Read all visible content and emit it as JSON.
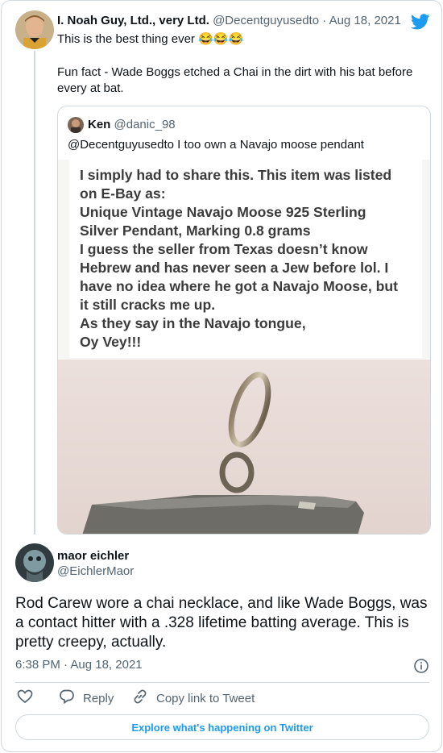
{
  "parent": {
    "name": "I. Noah Guy, Ltd., very Ltd.",
    "handle": "@Decentguyusedto",
    "dot": "·",
    "date": "Aug 18, 2021",
    "line1": "This is the best thing ever",
    "emojis": "😂😂😂",
    "text2": "Fun fact - Wade Boggs etched a Chai in the dirt with his bat before every at bat."
  },
  "quote": {
    "name": "Ken",
    "handle": "@danic_98",
    "text": "@Decentguyusedto I too own a Navajo moose pendant",
    "image_text": [
      "I simply had to share this. This item was listed",
      "on E-Bay as:",
      "Unique Vintage Navajo Moose 925 Sterling",
      "Silver Pendant, Marking 0.8 grams",
      "I guess the seller from Texas doesn’t know",
      "Hebrew and has never seen a Jew before lol. I",
      "have no idea where he got a Navajo Moose, but",
      "it still cracks me up.",
      "As they say in the Navajo tongue,",
      "Oy Vey!!!"
    ]
  },
  "reply": {
    "name": "maor eichler",
    "handle": "@EichlerMaor",
    "text": "Rod Carew wore a chai necklace, and like Wade Boggs, was a contact hitter with a .328 lifetime batting average. This is pretty creepy, actually.",
    "time": "6:38 PM",
    "dot": "·",
    "date": "Aug 18, 2021"
  },
  "actions": {
    "reply_label": "Reply",
    "copy_label": "Copy link to Tweet"
  },
  "explore_label": "Explore what's happening on Twitter",
  "icons": {
    "brand": "twitter-bird-icon",
    "like": "heart-icon",
    "reply": "speech-bubble-icon",
    "copy": "link-icon",
    "info": "info-icon"
  },
  "colors": {
    "accent": "#1d9bf0",
    "muted": "#536471",
    "border": "#cfd9de"
  }
}
